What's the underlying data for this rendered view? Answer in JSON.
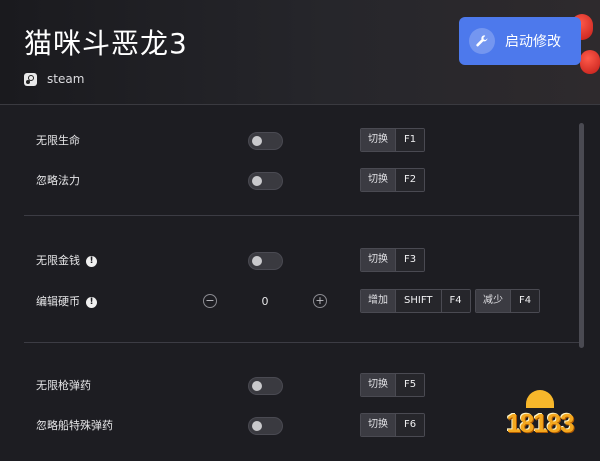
{
  "header": {
    "title": "猫咪斗恶龙3",
    "platform": "steam",
    "start_button": "启动修改"
  },
  "rows": [
    {
      "label": "无限生命",
      "action": "切换",
      "key": "F1"
    },
    {
      "label": "忽略法力",
      "action": "切换",
      "key": "F2"
    },
    {
      "label": "无限金钱",
      "action": "切换",
      "key": "F3"
    },
    {
      "label": "编辑硬币",
      "value": "0",
      "inc_action": "增加",
      "inc_mod": "SHIFT",
      "inc_key": "F4",
      "dec_action": "减少",
      "dec_key": "F4"
    },
    {
      "label": "无限枪弹药",
      "action": "切换",
      "key": "F5"
    },
    {
      "label": "忽略船特殊弹药",
      "action": "切换",
      "key": "F6"
    }
  ],
  "watermark": "18183",
  "colors": {
    "accent": "#4d79ec",
    "background": "#1d1d22"
  },
  "icons": {
    "start_button": "wrench-icon",
    "platform": "steam-icon",
    "info": "info-icon"
  }
}
